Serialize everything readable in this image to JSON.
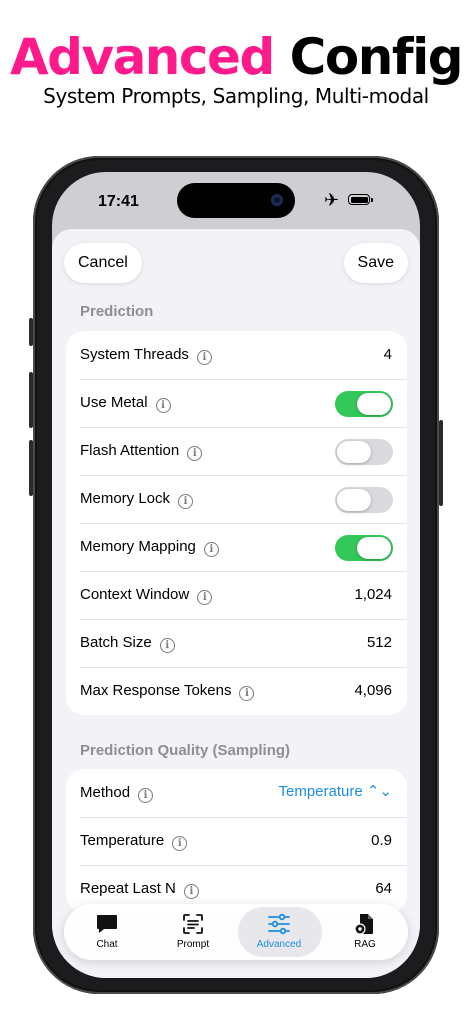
{
  "promo": {
    "title_accent": "Advanced",
    "title_rest": "Config",
    "subtitle": "System Prompts, Sampling, Multi-modal"
  },
  "status_bar": {
    "time": "17:41",
    "airplane_icon": "airplane-icon",
    "battery_icon": "battery-icon"
  },
  "nav": {
    "cancel": "Cancel",
    "save": "Save"
  },
  "sections": {
    "prediction": {
      "title": "Prediction",
      "rows": [
        {
          "label": "System Threads",
          "value": "4"
        },
        {
          "label": "Use Metal",
          "toggle": true
        },
        {
          "label": "Flash Attention",
          "toggle": false
        },
        {
          "label": "Memory Lock",
          "toggle": false
        },
        {
          "label": "Memory Mapping",
          "toggle": true
        },
        {
          "label": "Context Window",
          "value": "1,024"
        },
        {
          "label": "Batch Size",
          "value": "512"
        },
        {
          "label": "Max Response Tokens",
          "value": "4,096"
        }
      ]
    },
    "sampling": {
      "title": "Prediction Quality (Sampling)",
      "rows": [
        {
          "label": "Method",
          "value": "Temperature ⌃⌄"
        },
        {
          "label": "Temperature",
          "value": "0.9"
        },
        {
          "label": "Repeat Last N",
          "value": "64"
        }
      ]
    }
  },
  "tabs": [
    {
      "label": "Chat",
      "icon": "chat-bubble-icon"
    },
    {
      "label": "Prompt",
      "icon": "prompt-scan-icon"
    },
    {
      "label": "Advanced",
      "icon": "sliders-icon",
      "active": true
    },
    {
      "label": "RAG",
      "icon": "document-gear-icon"
    }
  ],
  "colors": {
    "accent": "#1e8fe0",
    "promo_pink": "#ff1a8c",
    "toggle_on": "#34c759"
  }
}
